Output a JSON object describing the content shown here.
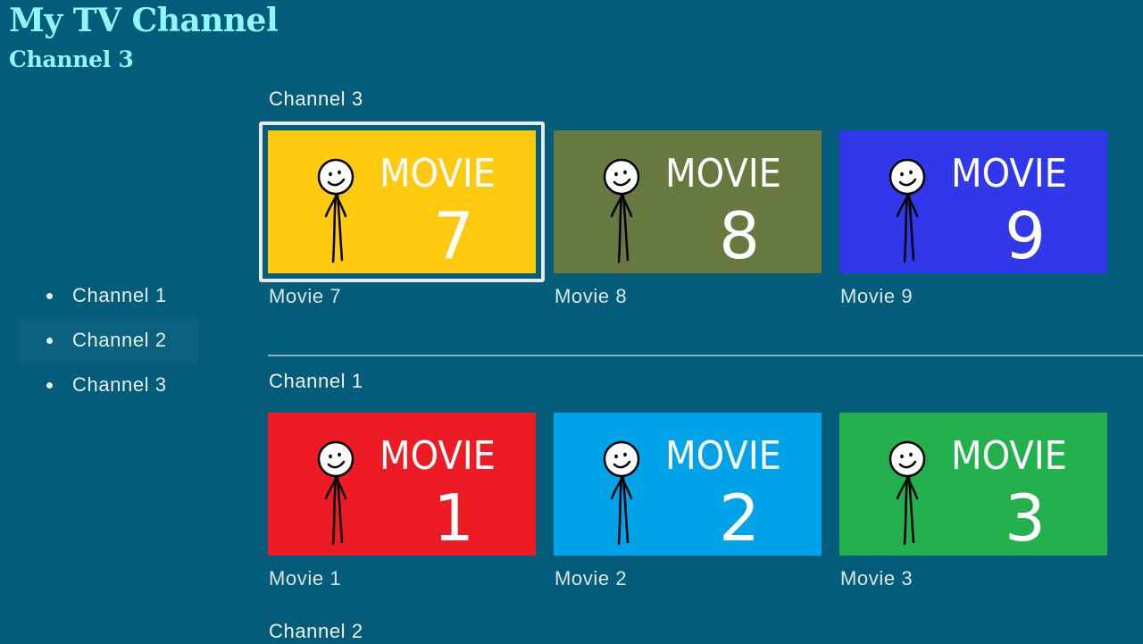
{
  "app": {
    "title": "My TV Channel",
    "subtitle": "Channel 3"
  },
  "nav": {
    "items": [
      {
        "label": "Channel 1"
      },
      {
        "label": "Channel 2"
      },
      {
        "label": "Channel 3"
      }
    ],
    "highlighted": "Channel 2"
  },
  "rows": [
    {
      "title": "Channel 3",
      "tiles": [
        {
          "label": "Movie 7",
          "poster_word": "MOVIE",
          "poster_number": "7",
          "color": "#fec90f",
          "focused": true
        },
        {
          "label": "Movie 8",
          "poster_word": "MOVIE",
          "poster_number": "8",
          "color": "#67793e",
          "focused": false
        },
        {
          "label": "Movie 9",
          "poster_word": "MOVIE",
          "poster_number": "9",
          "color": "#3038ea",
          "focused": false
        }
      ]
    },
    {
      "title": "Channel 1",
      "tiles": [
        {
          "label": "Movie 1",
          "poster_word": "MOVIE",
          "poster_number": "1",
          "color": "#ed1c24",
          "focused": false
        },
        {
          "label": "Movie 2",
          "poster_word": "MOVIE",
          "poster_number": "2",
          "color": "#00a2e8",
          "focused": false
        },
        {
          "label": "Movie 3",
          "poster_word": "MOVIE",
          "poster_number": "3",
          "color": "#22b14c",
          "focused": false
        }
      ]
    },
    {
      "title": "Channel 2",
      "tiles": []
    }
  ],
  "colors": {
    "background": "#035c79",
    "title": "#8ff7fa",
    "text": "#e6eef1",
    "focus_ring": "#e6eaec"
  }
}
